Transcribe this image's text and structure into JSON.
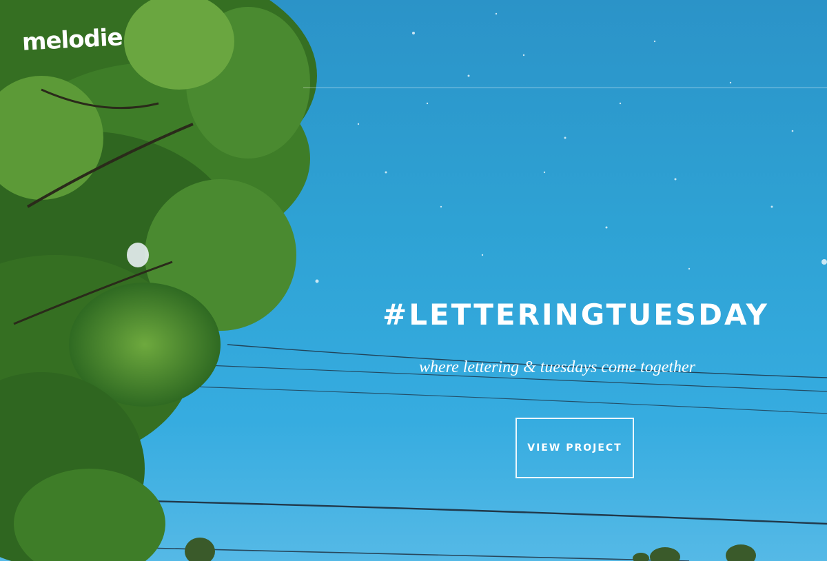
{
  "brand": {
    "logo_text": "melodie"
  },
  "hero": {
    "headline": "#LETTERINGTUESDAY",
    "tagline": "where lettering & tuesdays come together",
    "cta_label": "VIEW PROJECT"
  },
  "colors": {
    "sky": "#2ea2d4",
    "foliage": "#3f7f2a",
    "text": "#ffffff"
  }
}
